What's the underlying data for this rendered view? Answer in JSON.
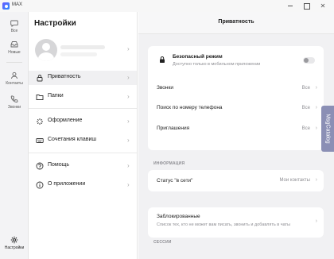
{
  "window": {
    "title": "MAX"
  },
  "rail": {
    "items": [
      {
        "label": "Все",
        "icon": "chat-icon"
      },
      {
        "label": "Новые",
        "icon": "inbox-icon"
      },
      {
        "label": "Контакты",
        "icon": "contacts-icon"
      },
      {
        "label": "Звонки",
        "icon": "phone-icon"
      }
    ],
    "settings_label": "Настройки"
  },
  "settings": {
    "title": "Настройки",
    "menu": [
      {
        "label": "Приватность",
        "icon": "lock-icon"
      },
      {
        "label": "Папки",
        "icon": "folder-icon"
      },
      {
        "label": "Оформление",
        "icon": "palette-icon"
      },
      {
        "label": "Сочетания клавиш",
        "icon": "keyboard-icon"
      },
      {
        "label": "Помощь",
        "icon": "help-icon"
      },
      {
        "label": "О приложении",
        "icon": "info-icon"
      }
    ]
  },
  "privacy": {
    "title": "Приватность",
    "safe_mode": {
      "label": "Безопасный режим",
      "subtitle": "Доступно только в мобильном приложении",
      "enabled": false
    },
    "rows": [
      {
        "label": "Звонки",
        "value": "Все"
      },
      {
        "label": "Поиск по номеру телефона",
        "value": "Все"
      },
      {
        "label": "Приглашения",
        "value": "Все"
      }
    ],
    "info_section": "ИНФОРМАЦИЯ",
    "online_status": {
      "label": "Статус \"в сети\"",
      "value": "Мои контакты"
    },
    "blocked": {
      "label": "Заблокированные",
      "subtitle": "Список тех, кто не может вам писать, звонить и добавлять в чаты"
    },
    "sessions_section": "СЕССИИ"
  },
  "side_tab": {
    "label": "MsgCatalog"
  },
  "colors": {
    "side_tab": "#8b8fb5",
    "active_menu": "#f0f0f2",
    "content_bg": "#f1f1f3"
  }
}
